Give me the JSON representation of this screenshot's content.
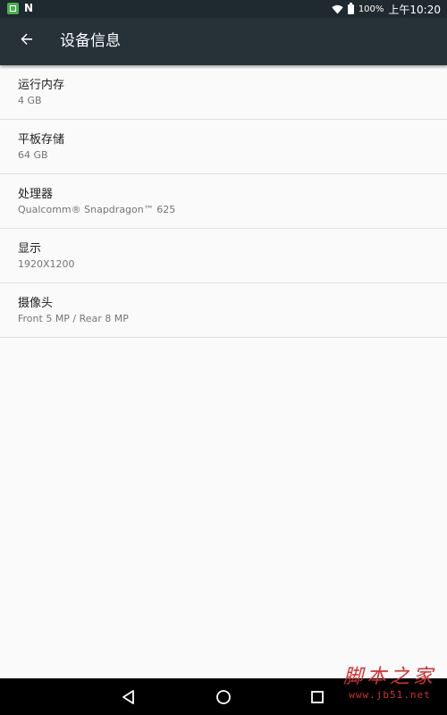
{
  "status_bar": {
    "notification_icons": [
      "app-icon",
      "nfc-icon"
    ],
    "nfc_glyph": "N",
    "battery": "100%",
    "time": "上午10:20"
  },
  "app_bar": {
    "title": "设备信息",
    "back_icon": "arrow-back-icon"
  },
  "items": [
    {
      "title": "运行内存",
      "summary": "4 GB"
    },
    {
      "title": "平板存储",
      "summary": "64 GB"
    },
    {
      "title": "处理器",
      "summary": "Qualcomm® Snapdragon™ 625"
    },
    {
      "title": "显示",
      "summary": "1920X1200"
    },
    {
      "title": "摄像头",
      "summary": "Front 5 MP / Rear 8 MP"
    }
  ],
  "nav_bar": {
    "buttons": [
      "back-triangle-icon",
      "home-circle-icon",
      "recents-square-icon"
    ]
  },
  "watermark": {
    "text": "脚本之家",
    "url": "www.jb51.net"
  },
  "colors": {
    "app_bar": "#263238",
    "status_bar": "#1f2a30",
    "background": "#fafafa",
    "divider": "#e0e0e0",
    "watermark": "#d32f2f"
  }
}
